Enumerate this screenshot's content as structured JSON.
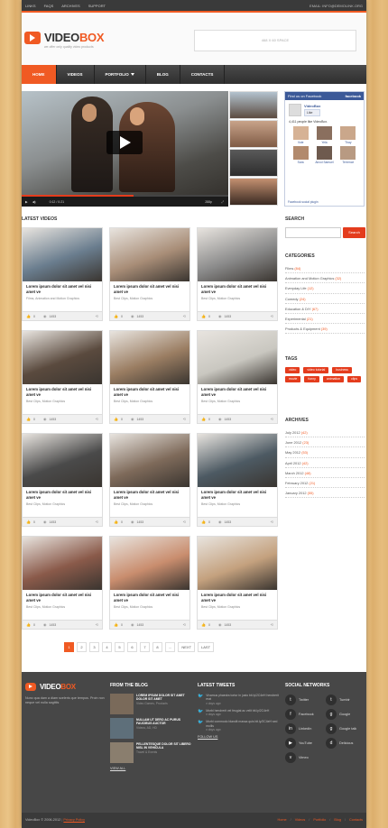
{
  "topbar": {
    "links": [
      "Links",
      "FAQs",
      "Archives",
      "Support"
    ],
    "contact": "EMAIL: INFO@DEMOLINK.ORG"
  },
  "header": {
    "logo_a": "VIDEO",
    "logo_b": "BOX",
    "tagline": "we offer only quality video products",
    "banner_text": "468 X 60 SPACE"
  },
  "nav": {
    "items": [
      "Home",
      "Videos",
      "Portfolio",
      "Blog",
      "Contacts"
    ],
    "active": "Home"
  },
  "player": {
    "time": "0:12 / 0:21",
    "quality": "288p",
    "progress": 0.54
  },
  "facebook": {
    "header_left": "Find us on Facebook",
    "header_right": "facebook",
    "page_name": "VideoBox",
    "like_label": "Like",
    "count_text": "4,411 people like VideoBox.",
    "fans": [
      "Vote",
      "Yela",
      "Thay",
      "Sara",
      "Aircol Samuel",
      "Terrence"
    ],
    "footer": "Facebook social plugin"
  },
  "latest": {
    "title": "Latest Videos",
    "cards": [
      {
        "title": "Lorem ipsum dolor sit amet vel nisi amet ve",
        "cat": "Films, Animation and Motion Graphics",
        "likes": "0",
        "views": "1453"
      },
      {
        "title": "Lorem ipsum dolor sit amet vel nisi amet ve",
        "cat": "Best Clips, Motion Graphics",
        "likes": "0",
        "views": "1453"
      },
      {
        "title": "Lorem ipsum dolor sit amet vel nisi amet ve",
        "cat": "Best Clips, Motion Graphics",
        "likes": "0",
        "views": "1453"
      },
      {
        "title": "Lorem ipsum dolor sit amet vel nisi amet ve",
        "cat": "Best Clips, Motion Graphics",
        "likes": "0",
        "views": "1453"
      },
      {
        "title": "Lorem ipsum dolor sit amet vel nisi amet ve",
        "cat": "Best Clips, Motion Graphics",
        "likes": "0",
        "views": "1453"
      },
      {
        "title": "Lorem ipsum dolor sit amet vel nisi amet ve",
        "cat": "Best Clips, Motion Graphics",
        "likes": "0",
        "views": "1453"
      },
      {
        "title": "Lorem ipsum dolor sit amet vel nisi amet ve",
        "cat": "Best Clips, Motion Graphics",
        "likes": "0",
        "views": "1453"
      },
      {
        "title": "Lorem ipsum dolor sit amet vel nisi amet ve",
        "cat": "Best Clips, Motion Graphics",
        "likes": "0",
        "views": "1453"
      },
      {
        "title": "Lorem ipsum dolor sit amet vel nisi amet ve",
        "cat": "Best Clips, Motion Graphics",
        "likes": "0",
        "views": "1453"
      },
      {
        "title": "Lorem ipsum dolor sit amet vel nisi amet ve",
        "cat": "Best Clips, Motion Graphics",
        "likes": "0",
        "views": "1453"
      },
      {
        "title": "Lorem ipsum dolor sit amet vel nisi amet ve",
        "cat": "Best Clips, Motion Graphics",
        "likes": "0",
        "views": "1453"
      },
      {
        "title": "Lorem ipsum dolor sit amet vel nisi amet ve",
        "cat": "Best Clips, Motion Graphics",
        "likes": "0",
        "views": "1453"
      }
    ],
    "card_colors": [
      "#6a7d8e",
      "#a88d77",
      "#8a8a8a",
      "#5a4a3e",
      "#9a7d62",
      "#c9c7c0",
      "#4a4a4a",
      "#7e6a5a",
      "#4d5a63",
      "#8a5a4a",
      "#c98d6e",
      "#c4a17e"
    ]
  },
  "pagination": [
    "1",
    "2",
    "3",
    "4",
    "5",
    "6",
    "7",
    "8",
    "...",
    "NEXT",
    "LAST"
  ],
  "search": {
    "title": "Search",
    "button": "Search",
    "placeholder": ""
  },
  "categories": {
    "title": "Categories",
    "items": [
      {
        "name": "Films",
        "count": "(84)"
      },
      {
        "name": "Animation and Motion Graphics",
        "count": "(32)"
      },
      {
        "name": "Everyday Life",
        "count": "(12)"
      },
      {
        "name": "Comedy",
        "count": "(24)"
      },
      {
        "name": "Education & DIY",
        "count": "(67)"
      },
      {
        "name": "Experimental",
        "count": "(21)"
      },
      {
        "name": "Products & Equipment",
        "count": "(39)"
      }
    ]
  },
  "tags": {
    "title": "Tags",
    "items": [
      "video",
      "video tutorial",
      "business",
      "movie",
      "funny",
      "animation",
      "clips"
    ]
  },
  "archives": {
    "title": "Archives",
    "items": [
      {
        "name": "July 2012",
        "count": "(42)"
      },
      {
        "name": "June 2012",
        "count": "(23)"
      },
      {
        "name": "May 2012",
        "count": "(53)"
      },
      {
        "name": "April 2012",
        "count": "(42)"
      },
      {
        "name": "March 2012",
        "count": "(48)"
      },
      {
        "name": "February 2012",
        "count": "(21)"
      },
      {
        "name": "January 2012",
        "count": "(55)"
      }
    ]
  },
  "footer": {
    "logo_a": "VIDEO",
    "logo_b": "BOX",
    "about": "Nunc qua dam a diam sceleris que tempus. Proin non neque vel nulla sagittis",
    "blog_title": "From the Blog",
    "blog": [
      {
        "title": "Lorem ipsum dolor sit amet dolor sit amet",
        "meta": "Video Games, Products"
      },
      {
        "title": "Nullam ut dero ac purus faucibus auctor",
        "meta": "Videos, AD, HD"
      },
      {
        "title": "Pellentesque dolor sit libero nisl in vehicula",
        "meta": "Travel & Events"
      }
    ],
    "view_all": "View All",
    "tweets_title": "Latest Tweets",
    "tweets": [
      {
        "text": "Vivamus phaedra tortor in justo bit.ly/2C4eH hendrerit erat",
        "time": "x days ago"
      },
      {
        "text": "Morbi hendrerit vel feugiat ac velit bit.ly/2C4eH",
        "time": "x days ago"
      },
      {
        "text": "Morbi commodo blandit massa quis bit.ly/2C4eH sed mollis",
        "time": "x days ago"
      }
    ],
    "follow_us": "Follow us",
    "social_title": "Social Networks",
    "social": [
      {
        "name": "Twitter",
        "icon": "twitter-icon",
        "glyph": "t"
      },
      {
        "name": "Tumblr",
        "icon": "tumblr-icon",
        "glyph": "t"
      },
      {
        "name": "Facebook",
        "icon": "facebook-icon",
        "glyph": "f"
      },
      {
        "name": "Google",
        "icon": "google-icon",
        "glyph": "g"
      },
      {
        "name": "LinkedIn",
        "icon": "linkedin-icon",
        "glyph": "in"
      },
      {
        "name": "Google talk",
        "icon": "google-talk-icon",
        "glyph": "g"
      },
      {
        "name": "YouTube",
        "icon": "youtube-icon",
        "glyph": "▶"
      },
      {
        "name": "Delicious",
        "icon": "delicious-icon",
        "glyph": "d"
      },
      {
        "name": "Vimeo",
        "icon": "vimeo-icon",
        "glyph": "v"
      }
    ]
  },
  "bottom": {
    "copyright": "VideoBox © 2006-2012",
    "privacy": "Privacy Policy",
    "links": [
      "Home",
      "Videos",
      "Portfolio",
      "Blog",
      "Contacts"
    ]
  },
  "colors": {
    "accent": "#f05a23",
    "accent_dark": "#e43c1d",
    "facebook": "#3b5998",
    "footer_bg": "#474747"
  }
}
